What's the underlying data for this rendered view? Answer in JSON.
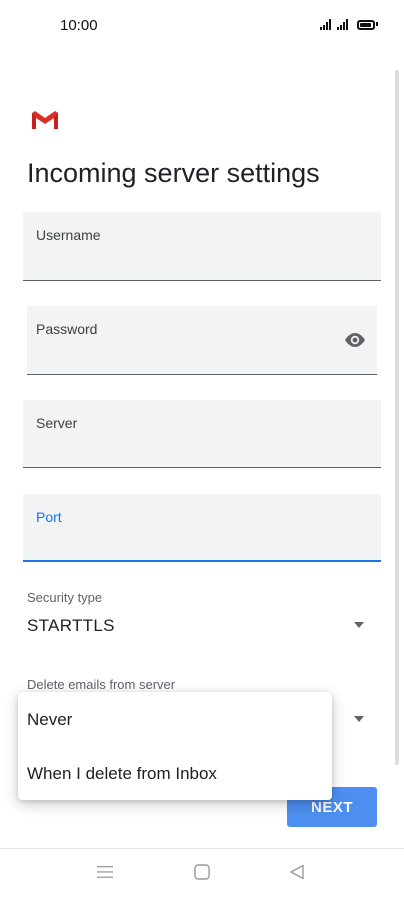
{
  "status_bar": {
    "time": "10:00"
  },
  "page": {
    "title": "Incoming server settings"
  },
  "fields": {
    "username": {
      "label": "Username",
      "value": ""
    },
    "password": {
      "label": "Password",
      "value": ""
    },
    "server": {
      "label": "Server",
      "value": ""
    },
    "port": {
      "label": "Port",
      "value": ""
    }
  },
  "security_type": {
    "label": "Security type",
    "value": "STARTTLS"
  },
  "delete_emails": {
    "label": "Delete emails from server"
  },
  "dropdown": {
    "options": [
      "Never",
      "When I delete from Inbox"
    ]
  },
  "buttons": {
    "next": "NEXT"
  },
  "colors": {
    "accent": "#1a73e8",
    "next_button": "#4d8ff0",
    "gmail_red": "#d93025"
  },
  "icons": [
    "gmail-logo",
    "eye-icon",
    "dropdown-caret-icon",
    "menu-icon",
    "home-icon",
    "back-icon",
    "signal-icon",
    "battery-icon"
  ]
}
